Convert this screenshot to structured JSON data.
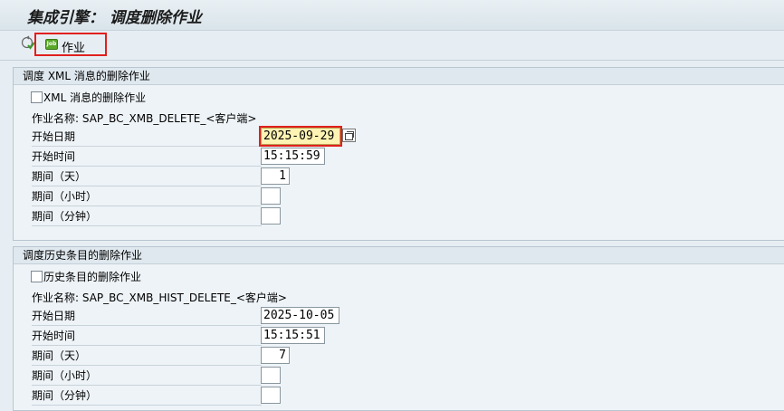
{
  "window": {
    "title": "集成引擎： 调度删除作业"
  },
  "toolbar": {
    "job_label": "作业",
    "job_icon_text": "Job"
  },
  "section_xml": {
    "header": "调度 XML 消息的删除作业",
    "checkbox_label": "XML 消息的删除作业",
    "checked": false,
    "job_name": "作业名称: SAP_BC_XMB_DELETE_<客户端>",
    "start_date_label": "开始日期",
    "start_date": "2025-09-29",
    "start_time_label": "开始时间",
    "start_time": "15:15:59",
    "period_days_label": "期间（天）",
    "period_days": "1",
    "period_hours_label": "期间（小时）",
    "period_hours": "",
    "period_minutes_label": "期间（分钟）",
    "period_minutes": ""
  },
  "section_history": {
    "header": "调度历史条目的删除作业",
    "checkbox_label": "历史条目的删除作业",
    "checked": false,
    "job_name": "作业名称: SAP_BC_XMB_HIST_DELETE_<客户端>",
    "start_date_label": "开始日期",
    "start_date": "2025-10-05",
    "start_time_label": "开始时间",
    "start_time": "15:15:51",
    "period_days_label": "期间（天）",
    "period_days": "7",
    "period_hours_label": "期间（小时）",
    "period_hours": "",
    "period_minutes_label": "期间（分钟）",
    "period_minutes": ""
  }
}
